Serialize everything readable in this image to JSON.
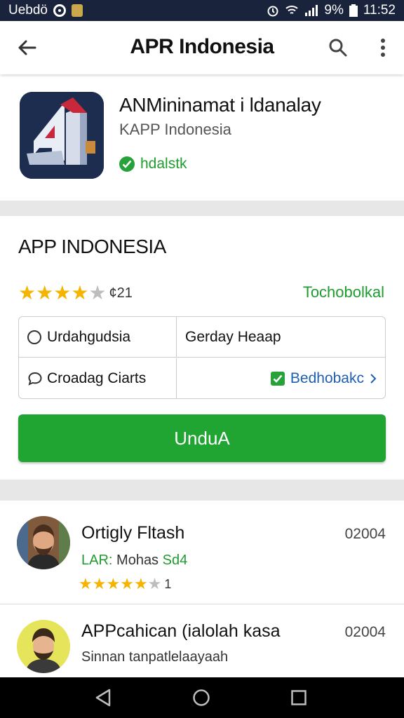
{
  "status_bar": {
    "carrier": "Uebdö",
    "time": "11:52",
    "battery": "9%"
  },
  "app_bar": {
    "title": "APR Indonesia"
  },
  "app_header": {
    "name": "ANMininamat i ldanalay",
    "developer": "KAPP Indonesia",
    "verified_label": "hdalstk"
  },
  "info": {
    "title": "APP INDONESIA",
    "rating": 4.5,
    "rating_count": "¢21",
    "tag": "Tochobolkal",
    "grid": {
      "cell1": "Urdahgudsia",
      "cell2": "Gerday Heaap",
      "cell3": "Croadag Ciarts",
      "cell4": "Bedhobakc"
    },
    "download_label": "UnduA"
  },
  "reviews": [
    {
      "name": "Ortigly Fltash",
      "date": "02004",
      "subtitle_prefix": "LAR:",
      "subtitle_text": "Mohas",
      "subtitle_suffix": "Sd4",
      "stars": 5,
      "count": "1"
    },
    {
      "name": "APPcahican (ialolah kasa",
      "date": "02004",
      "subtitle": "Sinnan tanpatlelaayaah"
    }
  ],
  "colors": {
    "accent_green": "#21a532",
    "status_bar_bg": "#19233c",
    "star_yellow": "#f4b400",
    "star_gray": "#bdbdbd",
    "link_blue": "#1f5fb0"
  }
}
